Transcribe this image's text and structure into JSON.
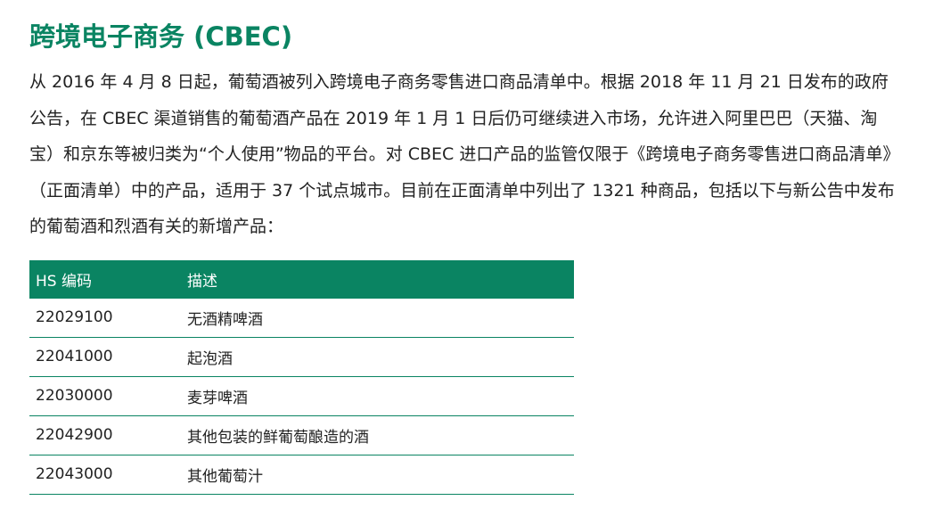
{
  "title": "跨境电子商务 (CBEC)",
  "paragraph": "从 2016 年 4 月 8 日起，葡萄酒被列入跨境电子商务零售进口商品清单中。根据 2018 年 11 月 21 日发布的政府公告，在 CBEC 渠道销售的葡萄酒产品在 2019 年 1 月 1 日后仍可继续进入市场，允许进入阿里巴巴（天猫、淘宝）和京东等被归类为“个人使用”物品的平台。对 CBEC 进口产品的监管仅限于《跨境电子商务零售进口商品清单》（正面清单）中的产品，适用于 37 个试点城市。目前在正面清单中列出了 1321 种商品，包括以下与新公告中发布的葡萄酒和烈酒有关的新增产品：",
  "table": {
    "headers": [
      "HS 编码",
      "描述"
    ],
    "rows": [
      [
        "22029100",
        "无酒精啤酒"
      ],
      [
        "22041000",
        "起泡酒"
      ],
      [
        "22030000",
        "麦芽啤酒"
      ],
      [
        "22042900",
        "其他包装的鲜葡萄酿造的酒"
      ],
      [
        "22043000",
        "其他葡萄汁"
      ]
    ]
  },
  "colors": {
    "accent": "#0a8462",
    "text": "#222222",
    "header_text": "#ffffff"
  }
}
